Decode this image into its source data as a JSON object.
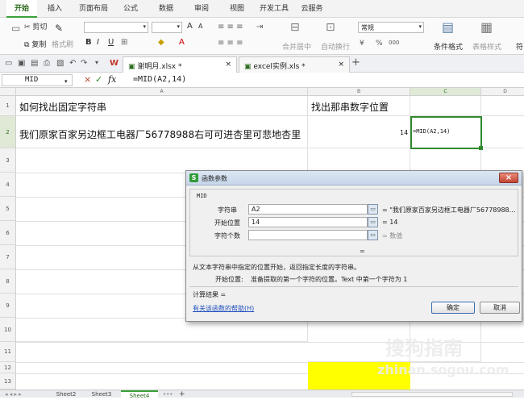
{
  "menu": {
    "tabs": [
      "开始",
      "插入",
      "页面布局",
      "公式",
      "数据",
      "审阅",
      "视图",
      "开发工具",
      "云服务"
    ]
  },
  "ribbon": {
    "cut": "剪切",
    "copy": "复制",
    "format_painter": "格式刷",
    "bold": "B",
    "italic": "I",
    "underline": "U",
    "font_grow": "A",
    "font_shrink": "A",
    "merge": "合并居中",
    "wrap": "自动换行",
    "number_format": "常规",
    "percent": "%",
    "thousands": "000",
    "conditional": "条件格式",
    "table_style": "表格样式",
    "symbol": "符"
  },
  "quickbar": {
    "doc_tabs": [
      {
        "name": "谢明月.xlsx *"
      },
      {
        "name": "excel实例.xls *"
      }
    ],
    "new_tab": "+"
  },
  "formula": {
    "cell_ref": "MID",
    "cancel": "×",
    "confirm": "✓",
    "fx": "fx",
    "content": "=MID(A2,14)"
  },
  "grid": {
    "columns": [
      "A",
      "B",
      "C",
      "D"
    ],
    "rows": [
      "1",
      "2",
      "3",
      "4",
      "5",
      "6",
      "7",
      "8",
      "9",
      "10",
      "11",
      "12",
      "13"
    ],
    "a1": "如何找出固定字符串",
    "b1": "找出那串数字位置",
    "a2": "我们原家百家另边框工电器厂56778988右可可进杏里可悲地杏里",
    "b2": "14",
    "c2": "=MID(A2,14)"
  },
  "sheets": {
    "tabs": [
      "Sheet2",
      "Sheet3",
      "Sheet4"
    ],
    "more": "•••",
    "add": "+"
  },
  "dialog": {
    "title": "函数参数",
    "function_name": "MID",
    "close": "×",
    "params": [
      {
        "label": "字符串",
        "value": "A2",
        "result": "= \"我们原家百家另边框工电器厂56778988…"
      },
      {
        "label": "开始位置",
        "value": "14",
        "result": "= 14"
      },
      {
        "label": "字符个数",
        "value": "",
        "result": "= 数值"
      }
    ],
    "result_eq": "=",
    "description": "从文本字符串中指定的位置开始，返回指定长度的字符串。",
    "param_desc_label": "开始位置:",
    "param_desc": "准备提取的第一个字符的位置。Text 中第一个字符为 1",
    "calc_result": "计算结果 =",
    "help_link": "有关该函数的帮助(H)",
    "ok": "确定",
    "cancel": "取消"
  },
  "watermark": {
    "brand": "搜狗指南",
    "url": "zhinan.sogou.com"
  },
  "colors": {
    "accent": "#3aa23a",
    "selection": "#2f8a2f",
    "yellow": "#ffff00"
  }
}
